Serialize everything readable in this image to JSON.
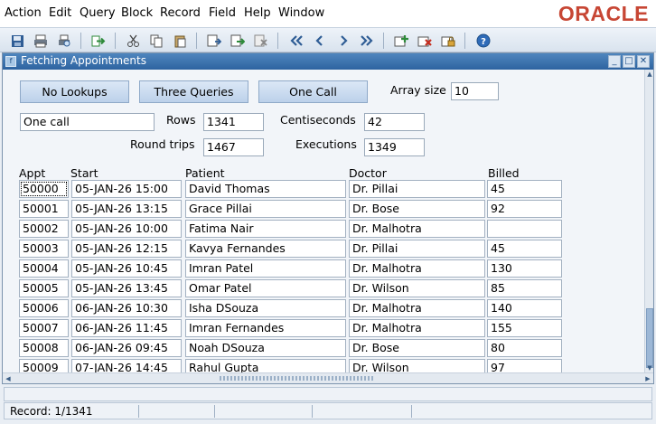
{
  "menubar": {
    "items": [
      "Action",
      "Edit",
      "Query",
      "Block",
      "Record",
      "Field",
      "Help",
      "Window"
    ],
    "logo": "ORACLE"
  },
  "toolbar": {
    "icons": [
      "save-icon",
      "print-icon",
      "print-preview-icon",
      "exit-icon",
      "cut-icon",
      "copy-icon",
      "paste-icon",
      "enter-query-icon",
      "execute-query-icon",
      "cancel-query-icon",
      "first-record-icon",
      "previous-record-icon",
      "next-record-icon",
      "last-record-icon",
      "insert-record-icon",
      "delete-record-icon",
      "lock-record-icon",
      "help-icon"
    ]
  },
  "window": {
    "title": "Fetching Appointments"
  },
  "controls": {
    "btn_no_lookups": "No Lookups",
    "btn_three_queries": "Three Queries",
    "btn_one_call": "One Call",
    "array_size_label": "Array size",
    "array_size_value": "10",
    "mode_value": "One call",
    "rows_label": "Rows",
    "rows_value": "1341",
    "centiseconds_label": "Centiseconds",
    "centiseconds_value": "42",
    "round_trips_label": "Round trips",
    "round_trips_value": "1467",
    "executions_label": "Executions",
    "executions_value": "1349"
  },
  "table": {
    "headers": {
      "appt": "Appt",
      "start": "Start",
      "patient": "Patient",
      "doctor": "Doctor",
      "billed": "Billed"
    },
    "rows": [
      {
        "appt": "50000",
        "start": "05-JAN-26 15:00",
        "patient": "David Thomas",
        "doctor": "Dr. Pillai",
        "billed": "45"
      },
      {
        "appt": "50001",
        "start": "05-JAN-26 13:15",
        "patient": "Grace Pillai",
        "doctor": "Dr. Bose",
        "billed": "92"
      },
      {
        "appt": "50002",
        "start": "05-JAN-26 10:00",
        "patient": "Fatima Nair",
        "doctor": "Dr. Malhotra",
        "billed": ""
      },
      {
        "appt": "50003",
        "start": "05-JAN-26 12:15",
        "patient": "Kavya Fernandes",
        "doctor": "Dr. Pillai",
        "billed": "45"
      },
      {
        "appt": "50004",
        "start": "05-JAN-26 10:45",
        "patient": "Imran Patel",
        "doctor": "Dr. Malhotra",
        "billed": "130"
      },
      {
        "appt": "50005",
        "start": "05-JAN-26 13:45",
        "patient": "Omar Patel",
        "doctor": "Dr. Wilson",
        "billed": "85"
      },
      {
        "appt": "50006",
        "start": "06-JAN-26 10:30",
        "patient": "Isha DSouza",
        "doctor": "Dr. Malhotra",
        "billed": "140"
      },
      {
        "appt": "50007",
        "start": "06-JAN-26 11:45",
        "patient": "Imran Fernandes",
        "doctor": "Dr. Malhotra",
        "billed": "155"
      },
      {
        "appt": "50008",
        "start": "06-JAN-26 09:45",
        "patient": "Noah DSouza",
        "doctor": "Dr. Bose",
        "billed": "80"
      },
      {
        "appt": "50009",
        "start": "07-JAN-26 14:45",
        "patient": "Rahul Gupta",
        "doctor": "Dr. Wilson",
        "billed": "97"
      }
    ]
  },
  "status": {
    "record": "Record: 1/1341"
  }
}
